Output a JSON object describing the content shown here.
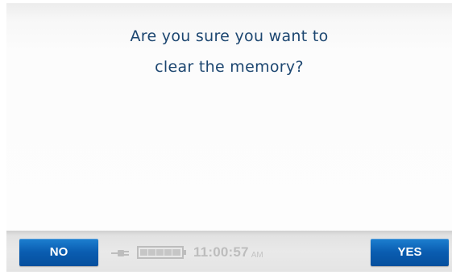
{
  "dialog": {
    "message_line_1": "Are you sure you want to",
    "message_line_2": "clear the memory?"
  },
  "buttons": {
    "no_label": "NO",
    "yes_label": "YES"
  },
  "status": {
    "power_icon": "plug-icon",
    "battery_icon": "battery-icon",
    "battery_level_fraction": 1.0,
    "time": "11:00:57",
    "ampm": "AM"
  },
  "colors": {
    "message_text": "#1c4670",
    "button_blue": "#0a5db1",
    "status_grey": "#bdbdbd"
  }
}
